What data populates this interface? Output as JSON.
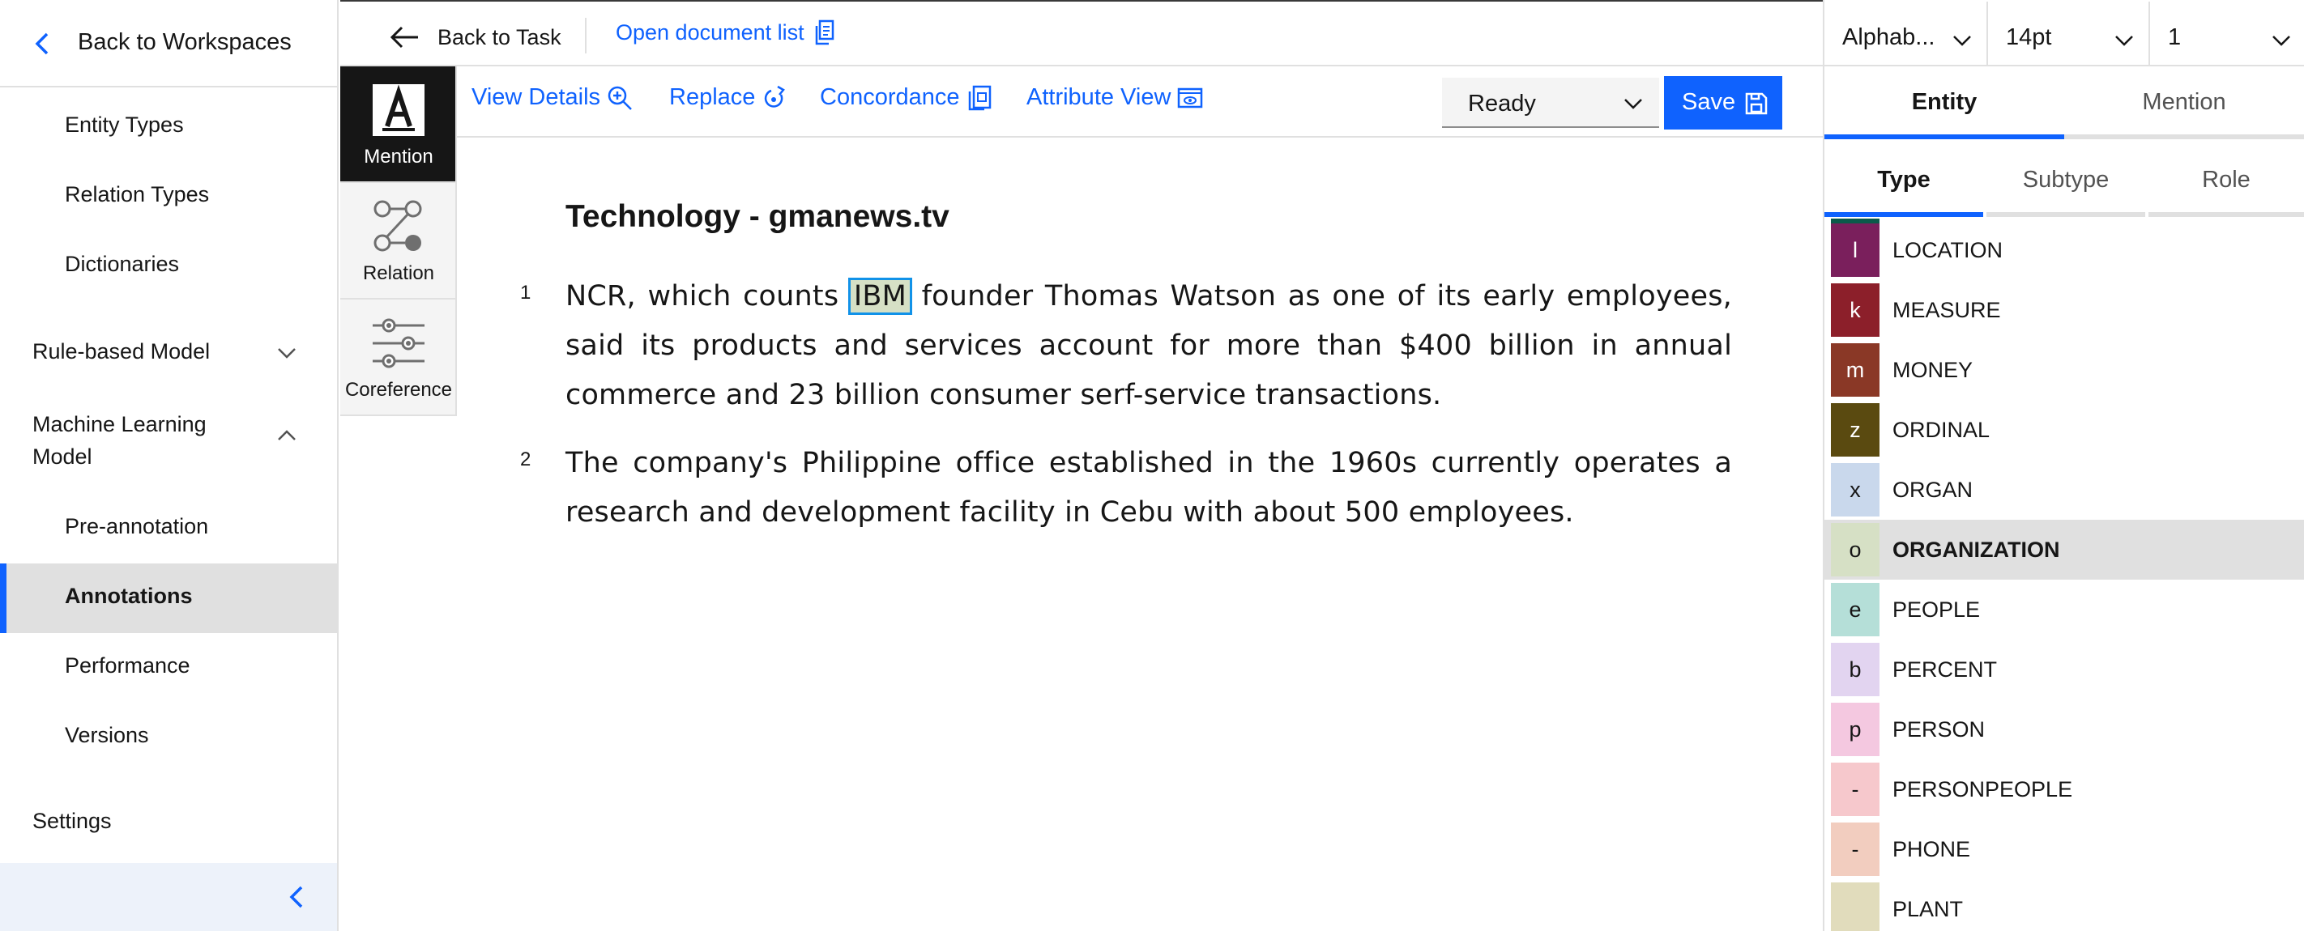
{
  "sidebar": {
    "back_label": "Back to Workspaces",
    "items": [
      {
        "label": "Entity Types"
      },
      {
        "label": "Relation Types"
      },
      {
        "label": "Dictionaries"
      }
    ],
    "rule_model": "Rule-based Model",
    "ml_model": "Machine Learning Model",
    "ml_items": [
      {
        "label": "Pre-annotation"
      },
      {
        "label": "Annotations"
      },
      {
        "label": "Performance"
      },
      {
        "label": "Versions"
      }
    ],
    "settings": "Settings"
  },
  "topbar": {
    "back_to_task": "Back to Task",
    "open_document_list": "Open document list"
  },
  "rail": {
    "mention": "Mention",
    "relation": "Relation",
    "coreference": "Coreference"
  },
  "toolbar": {
    "view_details": "View Details",
    "replace": "Replace",
    "concordance": "Concordance",
    "attribute_view": "Attribute View",
    "status": "Ready",
    "save": "Save"
  },
  "document": {
    "title": "Technology - gmanews.tv",
    "paragraphs": [
      {
        "num": "1",
        "before": "NCR, which counts ",
        "mention": "IBM",
        "after": " founder Thomas Watson as one of its early employees, said its products and services account for more than $400 billion in annual commerce and 23 billion consumer serf-service transactions."
      },
      {
        "num": "2",
        "text": "The company's Philippine office established in the 1960s currently operates a research and development facility in Cebu with about 500 employees."
      }
    ]
  },
  "right_panel": {
    "sort": "Alphab...",
    "font_size": "14pt",
    "level": "1",
    "tabs": [
      "Entity",
      "Mention"
    ],
    "subtabs": [
      "Type",
      "Subtype",
      "Role"
    ],
    "types": [
      {
        "key": "l",
        "name": "LOCATION",
        "bg": "#7a1f5c",
        "fg": "#ffffff"
      },
      {
        "key": "k",
        "name": "MEASURE",
        "bg": "#8c1f2a",
        "fg": "#ffffff"
      },
      {
        "key": "m",
        "name": "MONEY",
        "bg": "#8a3826",
        "fg": "#ffffff"
      },
      {
        "key": "z",
        "name": "ORDINAL",
        "bg": "#5a4a10",
        "fg": "#ffffff"
      },
      {
        "key": "x",
        "name": "ORGAN",
        "bg": "#c9d8ec",
        "fg": "#161616"
      },
      {
        "key": "o",
        "name": "ORGANIZATION",
        "bg": "#d6e0c5",
        "fg": "#161616"
      },
      {
        "key": "e",
        "name": "PEOPLE",
        "bg": "#b5dfd8",
        "fg": "#161616"
      },
      {
        "key": "b",
        "name": "PERCENT",
        "bg": "#e2d4f0",
        "fg": "#161616"
      },
      {
        "key": "p",
        "name": "PERSON",
        "bg": "#f4c8e0",
        "fg": "#161616"
      },
      {
        "key": "-",
        "name": "PERSONPEOPLE",
        "bg": "#f6c8cc",
        "fg": "#161616"
      },
      {
        "key": "-",
        "name": "PHONE",
        "bg": "#f2cdbf",
        "fg": "#161616"
      },
      {
        "key": "",
        "name": "PLANT",
        "bg": "#e1dcbc",
        "fg": "#161616"
      }
    ]
  },
  "colors": {
    "accent": "#0f62fe",
    "active_nav_bg": "#e0e0e0",
    "mention_highlight": "#d6e0c5",
    "mention_border": "#1192e8"
  }
}
